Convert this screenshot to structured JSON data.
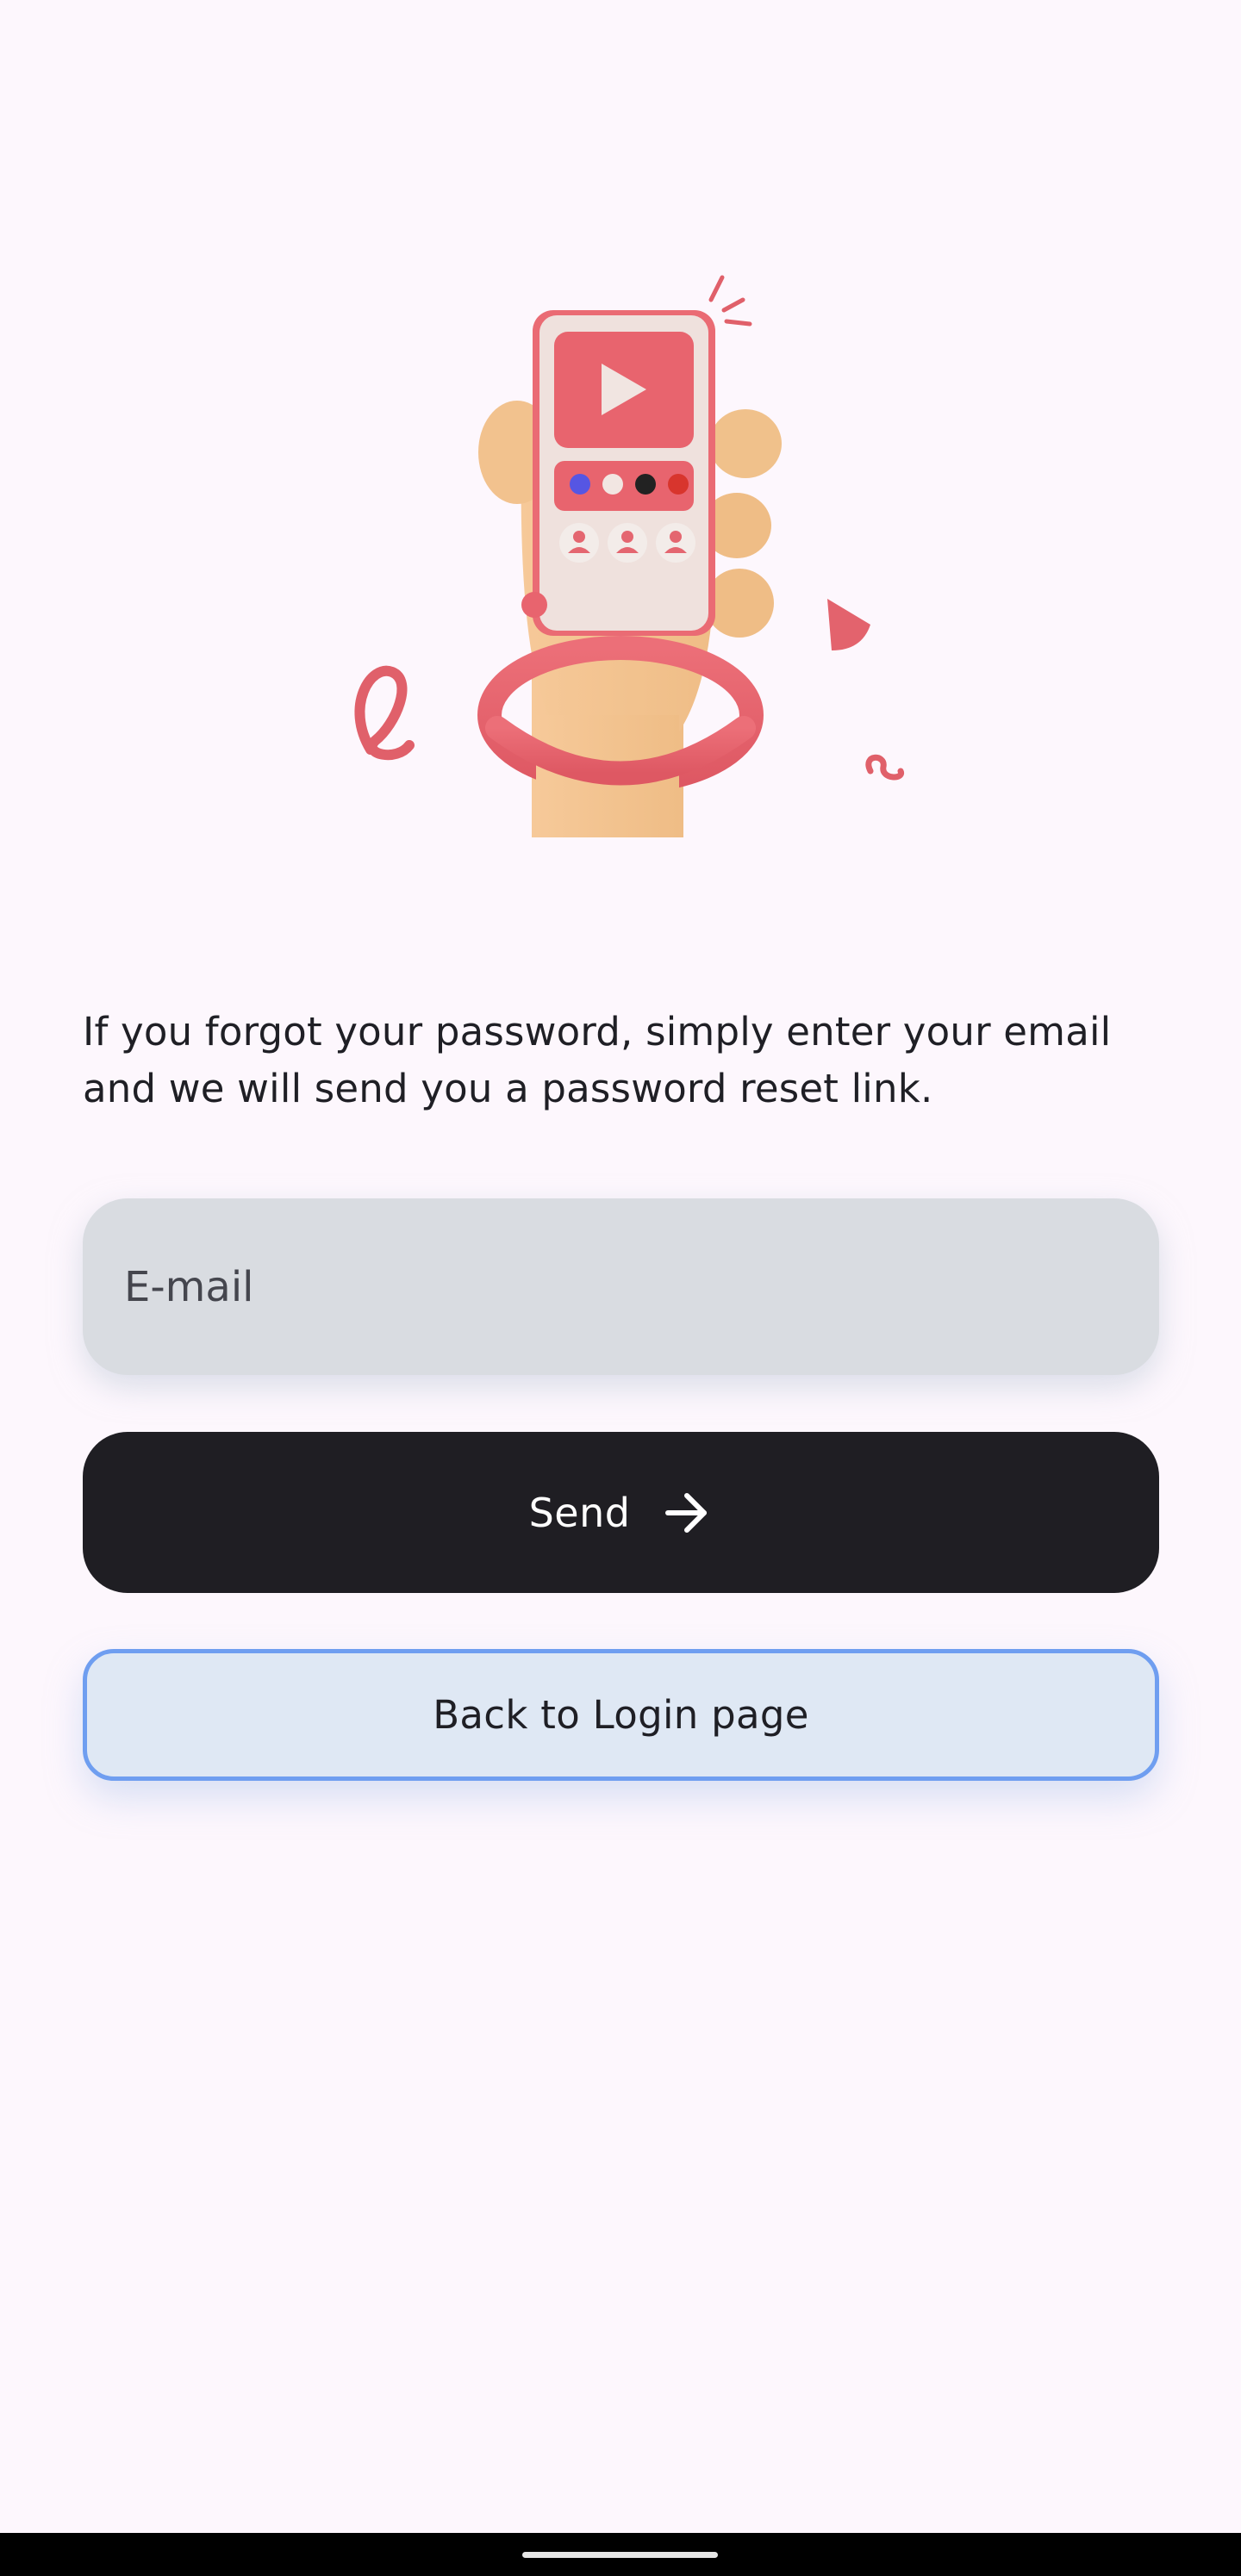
{
  "screen": {
    "illustration_description": "",
    "message": "If you forgot your password, simply enter your email and we will send you a password reset link."
  },
  "email_field": {
    "placeholder": "E-mail",
    "value": ""
  },
  "send_button": {
    "label": "Send",
    "icon": "arrow-right-icon"
  },
  "back_button": {
    "label": "Back to Login page"
  },
  "colors": {
    "background": "#fdf7fd",
    "primary_button": "#1f1e23",
    "secondary_button_border": "#6f9ef0",
    "secondary_button_fill": "#dfe8f4",
    "accent": "#e8626e"
  },
  "illustration": {
    "icons": [
      "hand-icon",
      "smartphone-icon",
      "play-icon",
      "ring-icon",
      "confetti-icon"
    ]
  }
}
